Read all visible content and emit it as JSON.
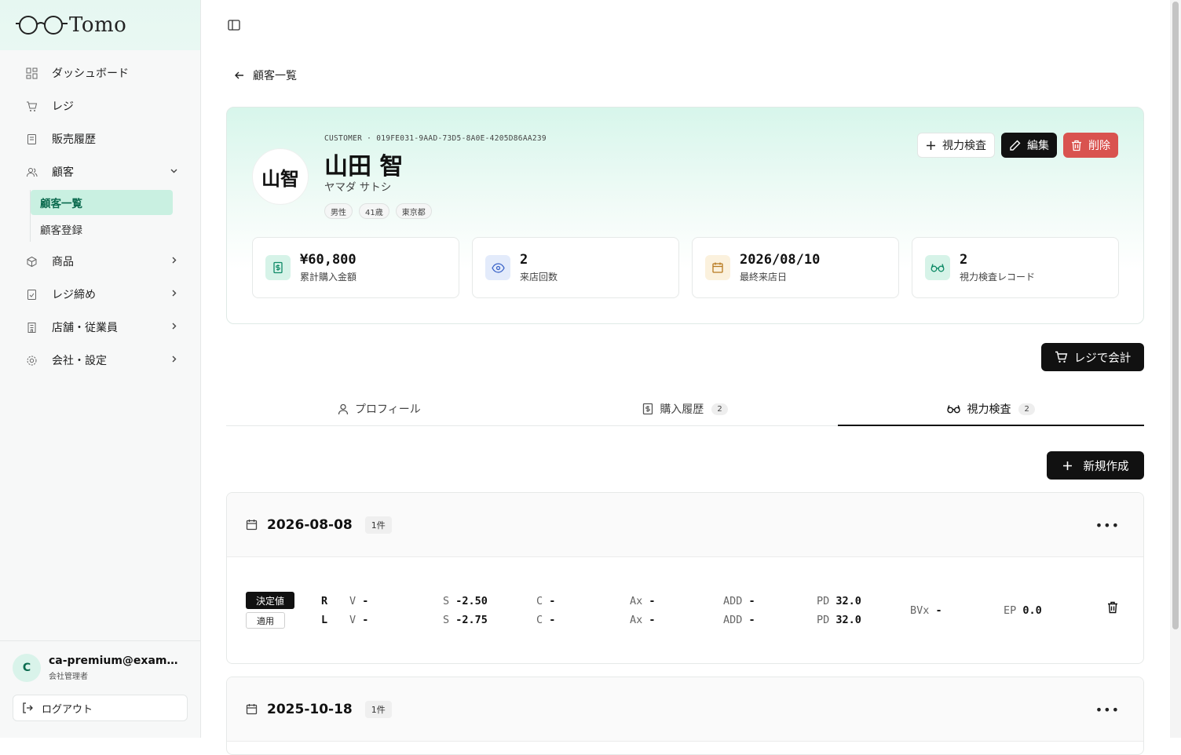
{
  "brand": {
    "name": "Tomo"
  },
  "sidebar": {
    "items": [
      {
        "label": "ダッシュボード",
        "icon": "dashboard-icon"
      },
      {
        "label": "レジ",
        "icon": "cart-icon"
      },
      {
        "label": "販売履歴",
        "icon": "receipt-icon"
      },
      {
        "label": "顧客",
        "icon": "users-icon",
        "expanded": true
      },
      {
        "label": "商品",
        "icon": "package-icon"
      },
      {
        "label": "レジ締め",
        "icon": "register-close-icon"
      },
      {
        "label": "店舗・従業員",
        "icon": "building-icon"
      },
      {
        "label": "会社・設定",
        "icon": "gear-icon"
      }
    ],
    "sub_items": [
      {
        "label": "顧客一覧",
        "active": true
      },
      {
        "label": "顧客登録",
        "active": false
      }
    ],
    "user": {
      "initial": "C",
      "email": "ca-premium@example.com",
      "role": "会社管理者"
    },
    "logout_label": "ログアウト"
  },
  "back_label": "顧客一覧",
  "customer": {
    "id_line": "CUSTOMER · 019FE031-9AAD-73D5-8A0E-4205D86AA239",
    "avatar_text": "山智",
    "name": "山田 智",
    "kana": "ヤマダ サトシ",
    "tags": [
      "男性",
      "41歳",
      "東京都"
    ]
  },
  "actions": {
    "eye_test": "視力検査",
    "edit": "編集",
    "delete": "削除"
  },
  "stats": [
    {
      "value": "¥60,800",
      "label": "累計購入金額",
      "icon": "receipt-icon",
      "color": "#d6f3e8"
    },
    {
      "value": "2",
      "label": "来店回数",
      "icon": "eye-icon",
      "color": "#e3ebfb"
    },
    {
      "value": "2026/08/10",
      "label": "最終来店日",
      "icon": "calendar-icon",
      "color": "#fbf1dd"
    },
    {
      "value": "2",
      "label": "視力検査レコード",
      "icon": "glasses-icon",
      "color": "#d6f3e8"
    }
  ],
  "checkout_label": "レジで会計",
  "tabs": [
    {
      "label": "プロフィール",
      "count": "",
      "icon": "user-icon"
    },
    {
      "label": "購入履歴",
      "count": "2",
      "icon": "receipt-icon"
    },
    {
      "label": "視力検査",
      "count": "2",
      "icon": "glasses-icon",
      "active": true
    }
  ],
  "new_label": "新規作成",
  "records": [
    {
      "date": "2026-08-08",
      "count": "1件",
      "badge_decided": "決定値",
      "badge_applied": "適用",
      "rows": [
        {
          "eye": "R",
          "V": "-",
          "S": "-2.50",
          "C": "-",
          "Ax": "-",
          "ADD": "-",
          "PD": "32.0"
        },
        {
          "eye": "L",
          "V": "-",
          "S": "-2.75",
          "C": "-",
          "Ax": "-",
          "ADD": "-",
          "PD": "32.0"
        }
      ],
      "BVx": "-",
      "EP": "0.0"
    },
    {
      "date": "2025-10-18",
      "count": "1件"
    }
  ],
  "colors": {
    "accent": "#c9f0e1",
    "danger": "#d9534f",
    "dark": "#111111"
  }
}
